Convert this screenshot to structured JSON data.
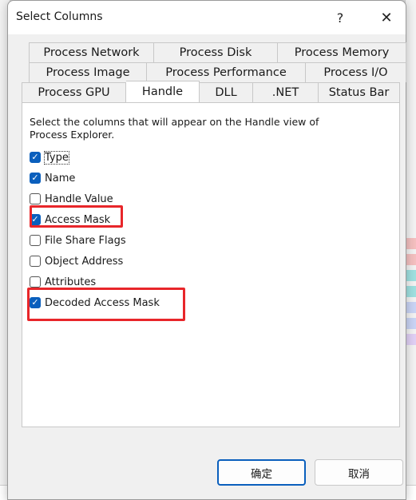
{
  "dialog": {
    "title": "Select Columns",
    "help_glyph": "?",
    "close_glyph": "✕"
  },
  "tabs": {
    "row1": [
      "Process Network",
      "Process Disk",
      "Process Memory"
    ],
    "row2": [
      "Process Image",
      "Process Performance",
      "Process I/O"
    ],
    "row3": [
      "Process GPU",
      "Handle",
      "DLL",
      ".NET",
      "Status Bar"
    ],
    "active": "Handle"
  },
  "panel": {
    "description": "Select the columns that will appear on the Handle view of Process Explorer.",
    "options": [
      {
        "label": "Type",
        "checked": true
      },
      {
        "label": "Name",
        "checked": true
      },
      {
        "label": "Handle Value",
        "checked": false
      },
      {
        "label": "Access Mask",
        "checked": true
      },
      {
        "label": "File Share Flags",
        "checked": false
      },
      {
        "label": "Object Address",
        "checked": false
      },
      {
        "label": "Attributes",
        "checked": false
      },
      {
        "label": "Decoded Access Mask",
        "checked": true
      }
    ]
  },
  "buttons": {
    "ok": "确定",
    "cancel": "取消"
  },
  "colors": {
    "accent": "#0a5fbd",
    "highlight": "#e8262a"
  },
  "icons": {
    "checkmark": "check-icon",
    "help": "help-icon",
    "close": "close-icon"
  }
}
